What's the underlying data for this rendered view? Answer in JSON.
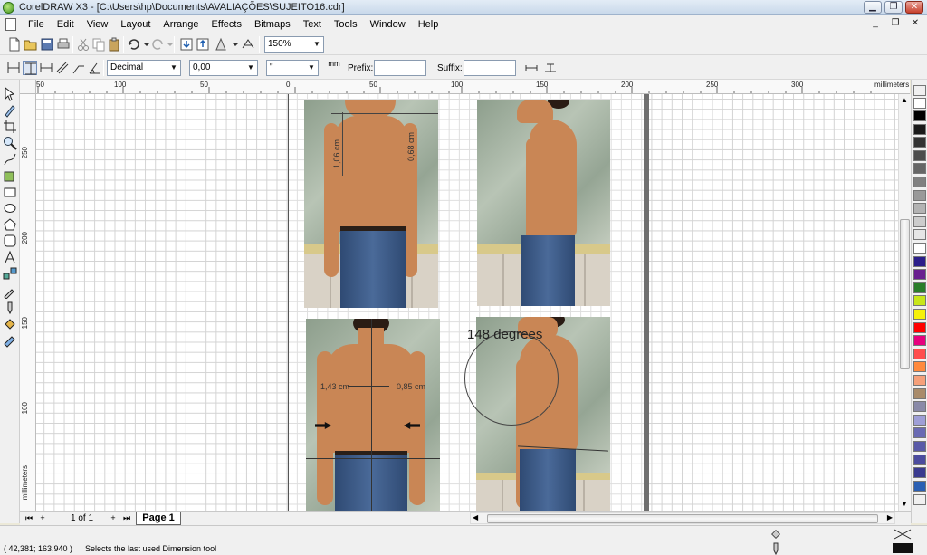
{
  "window": {
    "title": "CorelDRAW X3 - [C:\\Users\\hp\\Documents\\AVALIAÇÕES\\SUJEITO16.cdr]",
    "minimize": "▁",
    "maximize": "❐",
    "close": "✕"
  },
  "menu": {
    "items": [
      "File",
      "Edit",
      "View",
      "Layout",
      "Arrange",
      "Effects",
      "Bitmaps",
      "Text",
      "Tools",
      "Window",
      "Help"
    ],
    "mdi_minimize": "_",
    "mdi_restore": "❐",
    "mdi_close": "✕"
  },
  "toolbar": {
    "zoom_level": "150%"
  },
  "property_bar": {
    "units_style": "Decimal",
    "precision": "0,00",
    "units_symbol": "\"",
    "mm_button": "mm",
    "prefix_label": "Prefix:",
    "prefix_value": "",
    "suffix_label": "Suffix:",
    "suffix_value": ""
  },
  "rulers": {
    "horizontal": [
      "50",
      "100",
      "50",
      "0",
      "50",
      "100",
      "150",
      "200",
      "250",
      "300",
      "millimeters"
    ],
    "vertical": [
      "250",
      "200",
      "150",
      "100",
      "millimeters"
    ]
  },
  "canvas": {
    "front_left_measure": "1,06 cm",
    "front_right_measure": "0,68 cm",
    "back_left_measure": "1,43 cm",
    "back_right_measure": "0,85 cm",
    "angle_label": "148 degrees"
  },
  "page_nav": {
    "first": "⏮",
    "add_before": "+",
    "count": "1 of 1",
    "add_after": "+",
    "last": "⏭",
    "tab": "Page 1"
  },
  "status": {
    "coordinates": "( 42,381; 163,940 )",
    "message": "Selects the last used Dimension tool"
  },
  "palette": {
    "colors": [
      "#000000",
      "#1a1a1a",
      "#333333",
      "#4d4d4d",
      "#666666",
      "#808080",
      "#999999",
      "#b3b3b3",
      "#cccccc",
      "#e6e6e6",
      "#ffffff",
      "#2b1e8a",
      "#6a1f8f",
      "#2a7d2a",
      "#c8e61a",
      "#f6f10a",
      "#ff0000",
      "#e6007e",
      "#ff4d4d",
      "#ff8a3d",
      "#f5a07a",
      "#a98b6a",
      "#8a8aa8",
      "#9e9ed6",
      "#6a6ab3",
      "#5a5aa8",
      "#4b4b9e",
      "#3a3a8f",
      "#2a5fb3"
    ]
  },
  "colors": {
    "wall": "#9fae9c",
    "skin": "#c98655",
    "jeans": "#3b5a87"
  }
}
